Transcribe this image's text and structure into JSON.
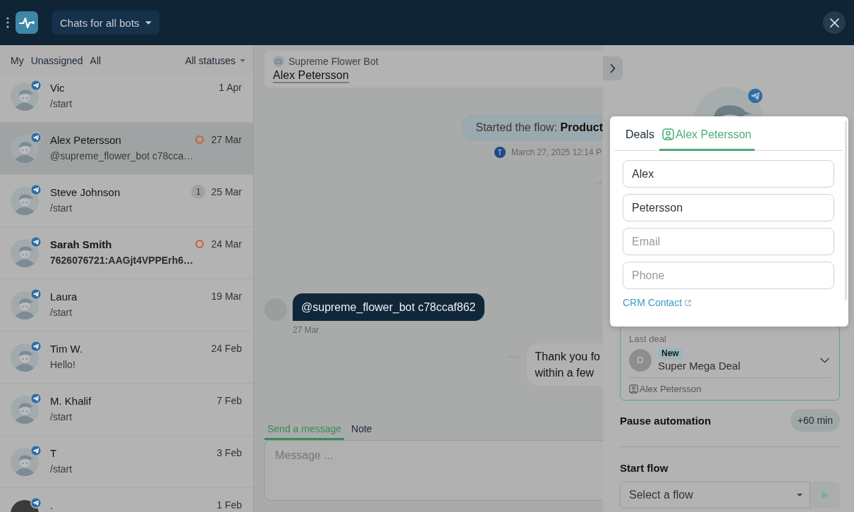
{
  "top_bar": {
    "bot_selector": "Chats for all bots"
  },
  "chat_filters": {
    "views": [
      "My",
      "Unassigned",
      "All"
    ],
    "status_filter": "All statuses"
  },
  "chats": [
    {
      "name": "Vic",
      "preview": "/start",
      "date": "1 Apr",
      "kind": "default",
      "selected": false,
      "unread": false,
      "status_ring": false
    },
    {
      "name": "Alex Petersson",
      "preview": "@supreme_flower_bot c78cca…",
      "date": "27 Mar",
      "kind": "default",
      "selected": true,
      "unread": false,
      "status_ring": true
    },
    {
      "name": "Steve Johnson",
      "preview": "/start",
      "date": "25 Mar",
      "kind": "default",
      "selected": false,
      "unread": false,
      "status_ring": false,
      "count": "1"
    },
    {
      "name": "Sarah Smith",
      "preview": "7626076721:AAGjt4VPPErh6…",
      "date": "24 Mar",
      "kind": "default",
      "selected": false,
      "unread": true,
      "status_ring": true
    },
    {
      "name": "Laura",
      "preview": "/start",
      "date": "19 Mar",
      "kind": "default",
      "selected": false,
      "unread": false,
      "status_ring": false
    },
    {
      "name": "Tim W.",
      "preview": "Hello!",
      "date": "24 Feb",
      "kind": "default",
      "selected": false,
      "unread": false,
      "status_ring": false
    },
    {
      "name": "M. Khalif",
      "preview": "/start",
      "date": "7 Feb",
      "kind": "default",
      "selected": false,
      "unread": false,
      "status_ring": false
    },
    {
      "name": "T",
      "preview": "/start",
      "date": "3 Feb",
      "kind": "default",
      "selected": false,
      "unread": false,
      "status_ring": false
    },
    {
      "name": ".",
      "date": "1 Feb",
      "kind": "photo",
      "selected": false,
      "unread": false,
      "status_ring": false
    }
  ],
  "conversation": {
    "bot_name": "Supreme Flower Bot",
    "contact_name": "Alex Petersson",
    "messages": [
      {
        "kind": "system",
        "text": "Started the flow: **Product**",
        "author_initial": "T",
        "time": "March 27, 2025 12:14 P"
      },
      {
        "kind": "incoming",
        "text": "@supreme_flower_bot c78ccaf862",
        "time": "27 Mar"
      },
      {
        "kind": "outgoing",
        "lines": [
          "Thank you fo",
          "within a few"
        ]
      }
    ],
    "composer": {
      "tabs": [
        {
          "label": "Send a message",
          "selected": true
        },
        {
          "label": "Note",
          "selected": false
        }
      ],
      "placeholder": "Message ..."
    }
  },
  "contact_panel": {
    "card": {
      "tabs": [
        {
          "label": "Deals",
          "kind": "plain",
          "selected": false
        },
        {
          "label": "Alex Petersson",
          "kind": "contact",
          "selected": true
        }
      ],
      "fields": [
        {
          "value": "Alex"
        },
        {
          "value": "Petersson"
        },
        {
          "placeholder": "Email"
        },
        {
          "placeholder": "Phone"
        }
      ],
      "crm_link": "CRM Contact"
    },
    "last_deal": {
      "label": "Last deal",
      "avatar_initial": "D",
      "stage": "New",
      "title": "Super Mega Deal",
      "contact": "Alex Petersson"
    },
    "pause_automation": {
      "label": "Pause automation",
      "button": "+60 min"
    },
    "start_flow": {
      "label": "Start flow",
      "placeholder": "Select a flow"
    }
  }
}
